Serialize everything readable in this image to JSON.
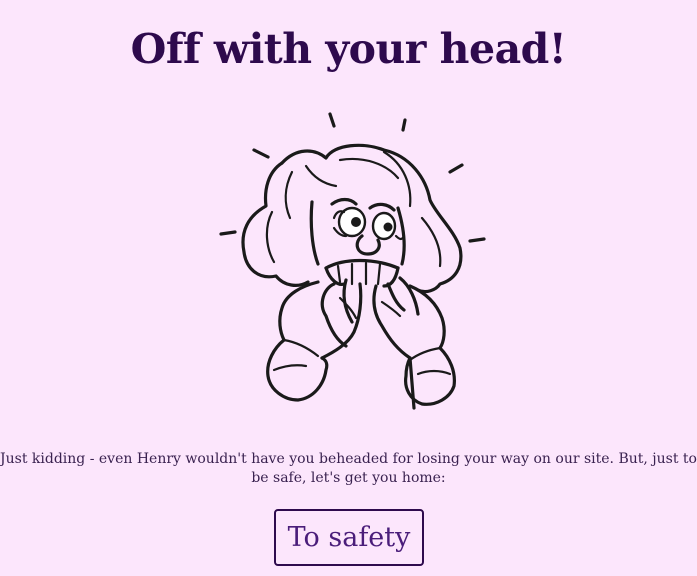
{
  "page": {
    "title": "Off with your head!",
    "message": "Just kidding - even Henry wouldn't have you beheaded for losing your way on our site. But, just to\nbe safe, let's get you home:",
    "cta_label": "To safety"
  },
  "illustration": {
    "icon": "scared-person-illustration"
  },
  "colors": {
    "background": "#fce6fc",
    "title": "#2e0a4d",
    "text": "#3a2250",
    "button_text": "#4a1d7a",
    "button_border": "#2e0a4d"
  }
}
